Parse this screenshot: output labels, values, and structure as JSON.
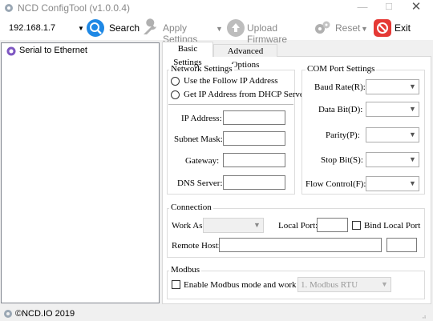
{
  "window": {
    "title": "NCD ConfigTool (v1.0.0.4)",
    "min_glyph": "—",
    "max_glyph": "☐",
    "close_glyph": "✕"
  },
  "toolbar": {
    "ip_value": "192.168.1.7",
    "search_label": "Search",
    "apply_label": "Apply Settings",
    "upload_label": "Upload Firmware",
    "reset_label": "Reset",
    "exit_label": "Exit",
    "dropdown_glyph": "▼"
  },
  "tree": {
    "items": [
      {
        "label": "Serial to Ethernet"
      }
    ]
  },
  "tabs": [
    {
      "label": "Basic Settings",
      "active": true
    },
    {
      "label": "Advanced Options",
      "active": false
    }
  ],
  "network": {
    "title": "Network Settings",
    "radio_follow": "Use the Follow IP Address",
    "radio_dhcp": "Get IP Address from DHCP Server",
    "ip_label": "IP Address:",
    "subnet_label": "Subnet Mask:",
    "gateway_label": "Gateway:",
    "dns_label": "DNS Server:",
    "ip_value": "",
    "subnet_value": "",
    "gateway_value": "",
    "dns_value": ""
  },
  "com": {
    "title": "COM Port Settings",
    "baud_label": "Baud Rate(R):",
    "databit_label": "Data Bit(D):",
    "parity_label": "Parity(P):",
    "stopbit_label": "Stop Bit(S):",
    "flow_label": "Flow Control(F):"
  },
  "connection": {
    "title": "Connection",
    "workas_label": "Work As",
    "localport_label": "Local Port:",
    "bind_label": "Bind Local Port",
    "remotehost_label": "Remote Host:"
  },
  "modbus": {
    "title": "Modbus",
    "enable_label": "Enable Modbus mode and work as",
    "mode_value": "1. Modbus RTU"
  },
  "status": {
    "text": "©NCD.IO 2019",
    "grip_glyph": "⣠"
  },
  "colors": {
    "exit_red": "#e53935",
    "search_blue": "#1e88e5",
    "disabled_gray": "#9e9e9e"
  }
}
